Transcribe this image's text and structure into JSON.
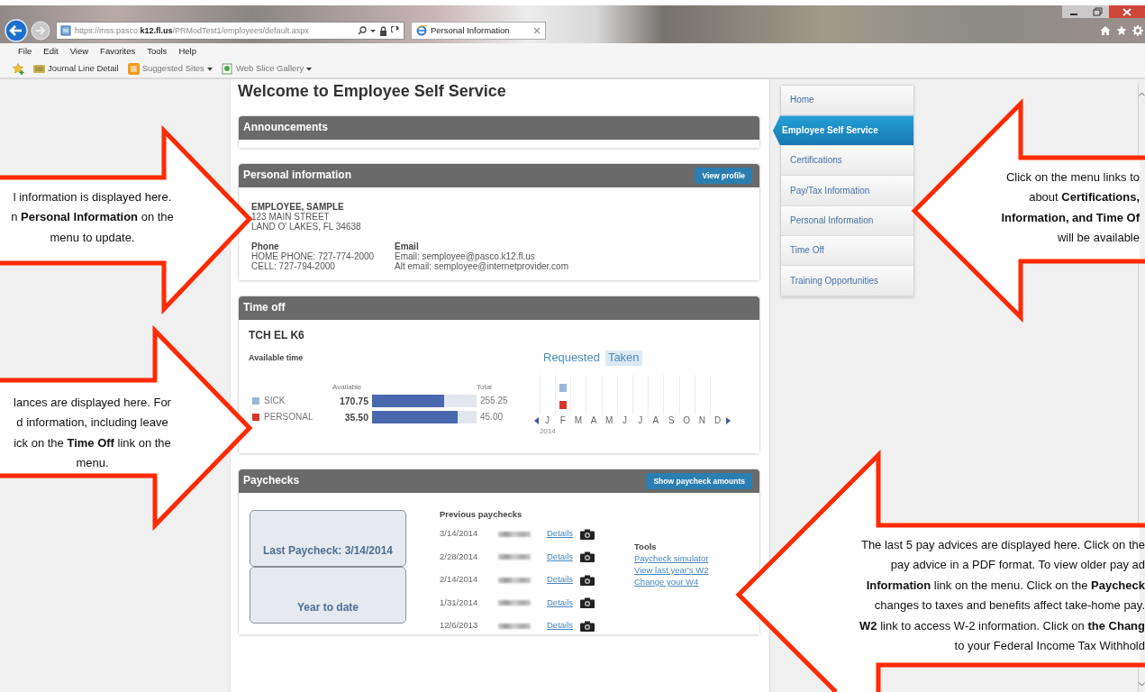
{
  "browser": {
    "address": "https://mss.pasco.**k12.fl.us**/PRModTest1/employees/default.aspx",
    "tab": "Personal Information",
    "menu": [
      "File",
      "Edit",
      "View",
      "Favorites",
      "Tools",
      "Help"
    ],
    "favorites": [
      {
        "label": "Journal Line Detail",
        "dropdown": false
      },
      {
        "label": "Suggested Sites",
        "dropdown": true
      },
      {
        "label": "Web Slice Gallery",
        "dropdown": true
      }
    ]
  },
  "page": {
    "title": "Welcome to Employee Self Service",
    "announcements": {
      "title": "Announcements"
    },
    "personal": {
      "title": "Personal information",
      "button": "View profile",
      "name": "EMPLOYEE, SAMPLE",
      "address": [
        "123 MAIN STREET",
        "LAND O' LAKES, FL 34638"
      ],
      "phone": {
        "heading": "Phone",
        "lines": [
          "HOME PHONE: 727-774-2000",
          "CELL: 727-794-2000"
        ]
      },
      "email": {
        "heading": "Email",
        "lines": [
          "Email: semployee@pasco.k12.fl.us",
          "Alt email: semployee@internetprovider.com"
        ]
      }
    },
    "time_off": {
      "title": "Time off",
      "position": "TCH EL K6",
      "subtitle": "Available time",
      "tabs": [
        {
          "label": "Requested",
          "selected": false
        },
        {
          "label": "Taken",
          "selected": true
        }
      ],
      "columns": [
        "Available",
        "Total"
      ],
      "balances": [
        {
          "type": "SICK",
          "color": "#9ab9de",
          "available": "170.75",
          "level": 0.69,
          "total": "255.25"
        },
        {
          "type": "PERSONAL",
          "color": "#d9352a",
          "available": "35.50",
          "level": 0.82,
          "total": "45.00"
        }
      ],
      "months": [
        {
          "label": "J",
          "sick_taken": false,
          "personal_taken": false
        },
        {
          "label": "F",
          "sick_taken": true,
          "personal_taken": true
        },
        {
          "label": "M",
          "sick_taken": false,
          "personal_taken": false
        },
        {
          "label": "A",
          "sick_taken": false,
          "personal_taken": false
        },
        {
          "label": "M",
          "sick_taken": false,
          "personal_taken": false
        },
        {
          "label": "J",
          "sick_taken": false,
          "personal_taken": false
        },
        {
          "label": "J",
          "sick_taken": false,
          "personal_taken": false
        },
        {
          "label": "A",
          "sick_taken": false,
          "personal_taken": false
        },
        {
          "label": "S",
          "sick_taken": false,
          "personal_taken": false
        },
        {
          "label": "O",
          "sick_taken": false,
          "personal_taken": false
        },
        {
          "label": "N",
          "sick_taken": false,
          "personal_taken": false
        },
        {
          "label": "D",
          "sick_taken": false,
          "personal_taken": false
        }
      ],
      "year": "2014"
    },
    "paychecks": {
      "title": "Paychecks",
      "button": "Show paycheck amounts",
      "summary": [
        "Last Paycheck: 3/14/2014",
        "Year to date"
      ],
      "previous_heading": "Previous paychecks",
      "rows": [
        {
          "date": "3/14/2014",
          "link": "Details"
        },
        {
          "date": "2/28/2014",
          "link": "Details"
        },
        {
          "date": "2/14/2014",
          "link": "Details"
        },
        {
          "date": "1/31/2014",
          "link": "Details"
        },
        {
          "date": "12/6/2013",
          "link": "Details"
        }
      ],
      "tools": {
        "heading": "Tools",
        "links": [
          "Paycheck simulator",
          "View last year's W2",
          "Change your W4"
        ]
      }
    }
  },
  "sidebar": {
    "items": [
      {
        "label": "Home",
        "selected": false
      },
      {
        "label": "Employee Self Service",
        "selected": true
      },
      {
        "label": "Certifications",
        "selected": false
      },
      {
        "label": "Pay/Tax Information",
        "selected": false
      },
      {
        "label": "Personal Information",
        "selected": false
      },
      {
        "label": "Time Off",
        "selected": false
      },
      {
        "label": "Training Opportunities",
        "selected": false
      }
    ]
  },
  "callouts": [
    {
      "lines": [
        "l information is displayed here.",
        "n **Personal Information** on the",
        "menu to update."
      ]
    },
    {
      "lines": [
        "lances are displayed here.  For",
        "d information, including leave",
        "ick on the **Time Off** link on the",
        "menu."
      ]
    },
    {
      "lines": [
        "Click on the menu links to",
        "about **Certifications,**",
        "**Information, and Time Of**",
        "will be available"
      ]
    },
    {
      "lines": [
        "The last 5 pay advices are displayed here.  Click on the",
        "pay advice in a PDF format.  To view older pay ad",
        "**Information** link on the menu.  Click on the **Paycheck**",
        "changes to taxes and benefits affect take-home pay.",
        "**W2** link to access W-2 information.  Click on **the Chang**",
        "to your Federal Income Tax Withhold"
      ]
    }
  ]
}
